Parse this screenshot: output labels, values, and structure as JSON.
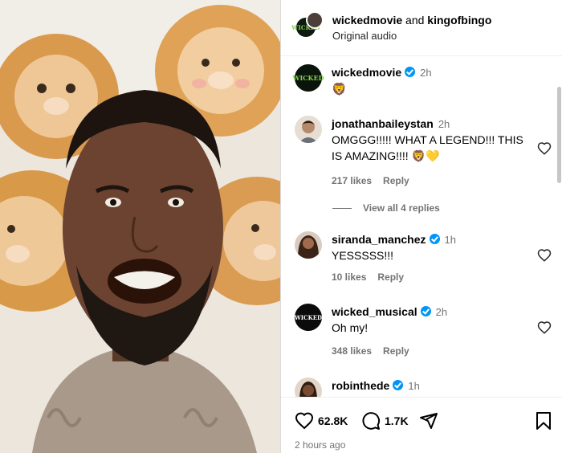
{
  "header": {
    "account_a": "wickedmovie",
    "conjunction": "and",
    "account_b": "kingofbingo",
    "audio": "Original audio"
  },
  "caption": {
    "username": "wickedmovie",
    "time": "2h",
    "text": "🦁",
    "avatar_label": "WICKED"
  },
  "comments": [
    {
      "username": "jonathanbaileystan",
      "time": "2h",
      "verified": false,
      "text": "OMGGG!!!!! WHAT A LEGEND!!! THIS IS AMAZING!!!! 🦁💛",
      "likes": "217 likes",
      "reply": "Reply"
    },
    {
      "username": "siranda_manchez",
      "time": "1h",
      "verified": true,
      "text": "YESSSSS!!!",
      "likes": "10 likes",
      "reply": "Reply"
    },
    {
      "username": "wicked_musical",
      "time": "2h",
      "verified": true,
      "text": "Oh my!",
      "likes": "348 likes",
      "reply": "Reply",
      "avatar_label": "WICKED"
    },
    {
      "username": "robinthede",
      "time": "1h",
      "verified": true
    }
  ],
  "view_replies": "View all 4 replies",
  "actions": {
    "like_count": "62.8K",
    "comment_count": "1.7K",
    "posted": "2 hours ago"
  },
  "colors": {
    "verified": "#0095f6",
    "muted": "#737373",
    "wicked_green": "#7fd34a"
  },
  "icons": [
    "heart-icon",
    "comment-icon",
    "share-icon",
    "bookmark-icon",
    "verified-badge-icon"
  ]
}
